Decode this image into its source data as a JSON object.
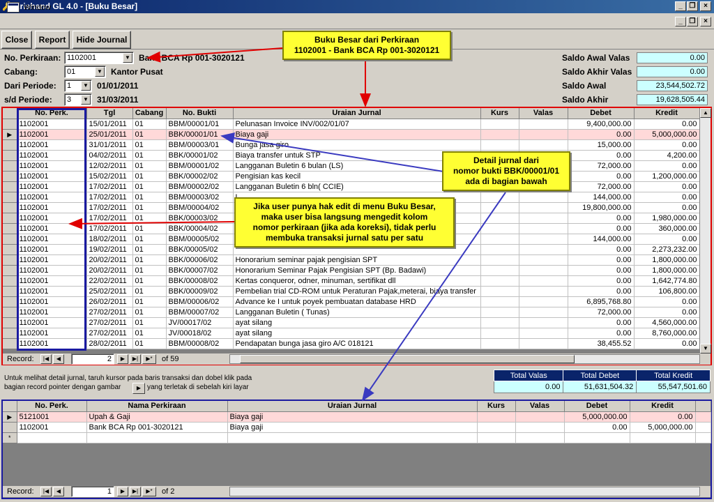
{
  "window": {
    "title": "Krishand GL 4.0 - [Buku Besar]",
    "menu_label": "Window"
  },
  "toolbar": {
    "close": "Close",
    "report": "Report",
    "hide_journal": "Hide Journal"
  },
  "filters": {
    "perkiraan_label": "No. Perkiraan:",
    "perkiraan_value": "1102001",
    "perkiraan_name": "Bank BCA Rp 001-3020121",
    "cabang_label": "Cabang:",
    "cabang_value": "01",
    "cabang_name": "Kantor Pusat",
    "dari_label": "Dari Periode:",
    "dari_value": "1",
    "dari_date": "01/01/2011",
    "sd_label": "s/d Periode:",
    "sd_value": "3",
    "sd_date": "31/03/2011"
  },
  "saldo": {
    "awal_valas_label": "Saldo Awal Valas",
    "awal_valas": "0.00",
    "akhir_valas_label": "Saldo Akhir Valas",
    "akhir_valas": "0.00",
    "awal_label": "Saldo Awal",
    "awal": "23,544,502.72",
    "akhir_label": "Saldo Akhir",
    "akhir": "19,628,505.44"
  },
  "callouts": {
    "top_line1": "Buku Besar dari Perkiraan",
    "top_line2": "1102001 - Bank BCA Rp 001-3020121",
    "right_line1": "Detail jurnal dari",
    "right_line2": "nomor bukti BBK/00001/01",
    "right_line3": "ada di bagian bawah",
    "mid_line1": "Jika user punya hak edit di menu Buku Besar,",
    "mid_line2": "maka user bisa langsung mengedit kolom",
    "mid_line3": "nomor perkiraan (jika ada koreksi), tidak perlu",
    "mid_line4": "membuka transaksi jurnal satu per satu"
  },
  "ledger": {
    "columns": [
      "No. Perk.",
      "Tgl",
      "Cabang",
      "No. Bukti",
      "Uraian Jurnal",
      "Kurs",
      "Valas",
      "Debet",
      "Kredit"
    ],
    "rows": [
      [
        "1102001",
        "15/01/2011",
        "01",
        "BBM/00001/01",
        "Pelunasan Invoice INV/002/01/07",
        "",
        "",
        "9,400,000.00",
        "0.00"
      ],
      [
        "1102001",
        "25/01/2011",
        "01",
        "BBK/00001/01",
        "Biaya gaji",
        "",
        "",
        "0.00",
        "5,000,000.00"
      ],
      [
        "1102001",
        "31/01/2011",
        "01",
        "BBM/00003/01",
        "Bunga jasa giro",
        "",
        "",
        "15,000.00",
        "0.00"
      ],
      [
        "1102001",
        "04/02/2011",
        "01",
        "BBK/00001/02",
        "Biaya transfer untuk STP",
        "",
        "",
        "0.00",
        "4,200.00"
      ],
      [
        "1102001",
        "12/02/2011",
        "01",
        "BBM/00001/02",
        "Langganan Buletin 6 bulan (LS)",
        "",
        "",
        "72,000.00",
        "0.00"
      ],
      [
        "1102001",
        "15/02/2011",
        "01",
        "BBK/00002/02",
        "Pengisian kas kecil",
        "",
        "",
        "0.00",
        "1,200,000.00"
      ],
      [
        "1102001",
        "17/02/2011",
        "01",
        "BBM/00002/02",
        "Langganan Buletin 6 bln( CCIE)",
        "",
        "",
        "72,000.00",
        "0.00"
      ],
      [
        "1102001",
        "17/02/2011",
        "01",
        "BBM/00003/02",
        "L",
        "",
        "",
        "144,000.00",
        "0.00"
      ],
      [
        "1102001",
        "17/02/2011",
        "01",
        "BBM/00004/02",
        "5",
        "",
        "",
        "19,800,000.00",
        "0.00"
      ],
      [
        "1102001",
        "17/02/2011",
        "01",
        "BBK/00003/02",
        "L",
        "",
        "",
        "0.00",
        "1,980,000.00"
      ],
      [
        "1102001",
        "17/02/2011",
        "01",
        "BBK/00004/02",
        "L",
        "",
        "",
        "0.00",
        "360,000.00"
      ],
      [
        "1102001",
        "18/02/2011",
        "01",
        "BBM/00005/02",
        "L",
        "",
        "",
        "144,000.00",
        "0.00"
      ],
      [
        "1102001",
        "19/02/2011",
        "01",
        "BBK/00005/02",
        "",
        "",
        "",
        "0.00",
        "2,273,232.00"
      ],
      [
        "1102001",
        "20/02/2011",
        "01",
        "BBK/00006/02",
        "Honorarium seminar pajak pengisian SPT",
        "",
        "",
        "0.00",
        "1,800,000.00"
      ],
      [
        "1102001",
        "20/02/2011",
        "01",
        "BBK/00007/02",
        "Honorarium Seminar Pajak Pengisian SPT (Bp. Badawi)",
        "",
        "",
        "0.00",
        "1,800,000.00"
      ],
      [
        "1102001",
        "22/02/2011",
        "01",
        "BBK/00008/02",
        "Kertas conqueror, odner, minuman, sertifikat dll",
        "",
        "",
        "0.00",
        "1,642,774.80"
      ],
      [
        "1102001",
        "25/02/2011",
        "01",
        "BBK/00009/02",
        "Pembelian trial CD-ROM untuk Peraturan Pajak,meterai, biaya transfer",
        "",
        "",
        "0.00",
        "106,800.00"
      ],
      [
        "1102001",
        "26/02/2011",
        "01",
        "BBM/00006/02",
        "Advance ke I untuk poyek pembuatan database HRD",
        "",
        "",
        "6,895,768.80",
        "0.00"
      ],
      [
        "1102001",
        "27/02/2011",
        "01",
        "BBM/00007/02",
        "Langganan Buletin ( Tunas)",
        "",
        "",
        "72,000.00",
        "0.00"
      ],
      [
        "1102001",
        "27/02/2011",
        "01",
        "JV/00017/02",
        "ayat silang",
        "",
        "",
        "0.00",
        "4,560,000.00"
      ],
      [
        "1102001",
        "27/02/2011",
        "01",
        "JV/00018/02",
        "ayat silang",
        "",
        "",
        "0.00",
        "8,760,000.00"
      ],
      [
        "1102001",
        "28/02/2011",
        "01",
        "BBM/00008/02",
        "Pendapatan bunga jasa giro A/C 018121",
        "",
        "",
        "38,455.52",
        "0.00"
      ]
    ],
    "record_label": "Record:",
    "record_current": "2",
    "record_of": "of 59"
  },
  "totals": {
    "headers": [
      "Total Valas",
      "Total Debet",
      "Total Kredit"
    ],
    "values": [
      "0.00",
      "51,631,504.32",
      "55,547,501.60"
    ]
  },
  "info": {
    "line1": "Untuk melihat detail jurnal, taruh kursor pada baris transaksi dan dobel klik pada",
    "line2a": "bagian record pointer dengan gambar",
    "line2b": "yang terletak di sebelah kiri layar"
  },
  "detail": {
    "columns": [
      "No. Perk.",
      "Nama Perkiraan",
      "Uraian Jurnal",
      "Kurs",
      "Valas",
      "Debet",
      "Kredit"
    ],
    "rows": [
      [
        "5121001",
        "Upah & Gaji",
        "Biaya gaji",
        "",
        "",
        "5,000,000.00",
        "0.00"
      ],
      [
        "1102001",
        "Bank BCA Rp 001-3020121",
        "Biaya gaji",
        "",
        "",
        "0.00",
        "5,000,000.00"
      ]
    ],
    "record_label": "Record:",
    "record_current": "1",
    "record_of": "of 2"
  },
  "colors": {
    "red_frame": "#e00000",
    "blue_frame": "#1a1aa0",
    "callout": "#ffff33",
    "title_bar": "#0a246a"
  }
}
